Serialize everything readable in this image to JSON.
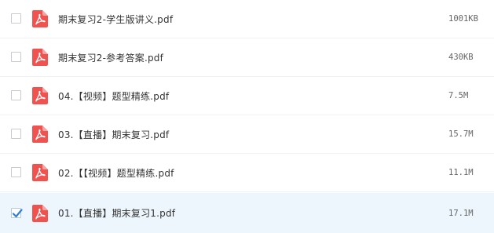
{
  "files": [
    {
      "name": "期末复习2-学生版讲义.pdf",
      "size": "1001KB",
      "selected": false
    },
    {
      "name": "期末复习2-参考答案.pdf",
      "size": "430KB",
      "selected": false
    },
    {
      "name": "04.【视频】题型精练.pdf",
      "size": "7.5M",
      "selected": false
    },
    {
      "name": "03.【直播】期末复习.pdf",
      "size": "15.7M",
      "selected": false
    },
    {
      "name": "02.【【视频】题型精练.pdf",
      "size": "11.1M",
      "selected": false
    },
    {
      "name": "01.【直播】期末复习1.pdf",
      "size": "17.1M",
      "selected": true
    }
  ],
  "icon": {
    "type": "pdf-icon",
    "color": "#f0534f"
  },
  "colors": {
    "selected_row": "#eef6fd",
    "checkmark": "#2f7fd6"
  }
}
